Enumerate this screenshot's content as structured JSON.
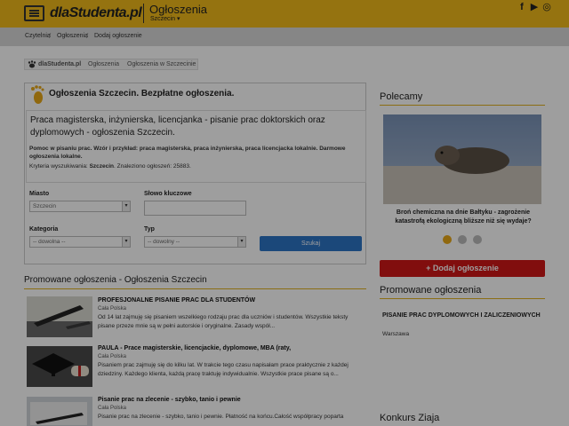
{
  "header": {
    "logo": "dlaStudenta.pl",
    "section_title": "Ogłoszenia",
    "city_selector": "Szczecin ▾",
    "social": {
      "facebook": "f",
      "youtube": "▶",
      "instagram": "◎"
    },
    "icons": [
      "menu-icon",
      "facebook-icon",
      "youtube-icon",
      "instagram-icon"
    ]
  },
  "topcrumbs": [
    "Czytelnia",
    "Ogłoszenia",
    "Dodaj ogłoszenie"
  ],
  "breadcrumb": [
    "dlaStudenta.pl",
    "Ogłoszenia",
    "Ogłoszenia w Szczecinie"
  ],
  "board": {
    "heading": "Ogłoszenia Szczecin. Bezpłatne ogłoszenia.",
    "title": "Praca magisterska, inżynierska, licencjanka - pisanie prac doktorskich oraz dyplomowych - ogłoszenia Szczecin.",
    "description": "Pomoc w pisaniu prac. Wzór i przykład: praca magisterska, praca inżynierska, praca licencjacka lokalnie. Darmowe ogłoszenia lokalne.",
    "criteria_prefix": "Kryteria wyszukiwania: ",
    "criteria_city": "Szczecin",
    "criteria_suffix": ". Znaleziono ogłoszeń: 25883."
  },
  "search": {
    "city_label": "Miasto",
    "city_value": "Szczecin",
    "keyword_label": "Słowo kluczowe",
    "keyword_value": "",
    "category_label": "Kategoria",
    "category_value": "-- dowolna --",
    "type_label": "Typ",
    "type_value": "-- dowolny --",
    "button": "Szukaj"
  },
  "promoted": {
    "heading": "Promowane ogłoszenia - Ogłoszenia Szczecin",
    "items": [
      {
        "title": "PROFESJONALNE PISANIE PRAC DLA STUDENTÓW",
        "location": "Cała Polska",
        "text": "Od 14 lat zajmuję się pisaniem wszelkiego rodzaju prac dla uczniów i studentów. Wszystkie teksty pisane przeze mnie są w pełni autorskie i oryginalne. Zasady współ..."
      },
      {
        "title": "PAULA - Prace magisterskie, licencjackie, dyplomowe, MBA (raty,",
        "location": "Cała Polska",
        "text": "Pisaniem prac zajmuję się do kilku lat. W trakcie tego czasu napisałam prace praktycznie z każdej dziedziny. Każdego klienta, każdą pracę traktuję indywidualnie. Wszystkie prace pisane są o..."
      },
      {
        "title": "Pisanie prac na zlecenie - szybko, tanio i pewnie",
        "location": "Cała Polska",
        "text": "Pisanie prac na zlecenie - szybko, tanio i pewnie. Płatność na końcu.Całość współpracy poparta"
      }
    ]
  },
  "sidebar": {
    "recommended_heading": "Polecamy",
    "recommended_caption": "Broń chemiczna na dnie Bałtyku - zagrożenie katastrofą ekologiczną bliższe niż się wydaje?",
    "add_button": "+ Dodaj ogłoszenie",
    "promoted_heading": "Promowane ogłoszenia",
    "promoted_item_title": "PISANIE PRAC DYPLOMOWYCH I ZALICZENIOWYCH",
    "promoted_item_location": "Warszawa",
    "contest_heading": "Konkurs Ziaja"
  },
  "colors": {
    "brand": "#f0ba1a",
    "add_button": "#d01818",
    "search_button": "#2d74c6"
  }
}
